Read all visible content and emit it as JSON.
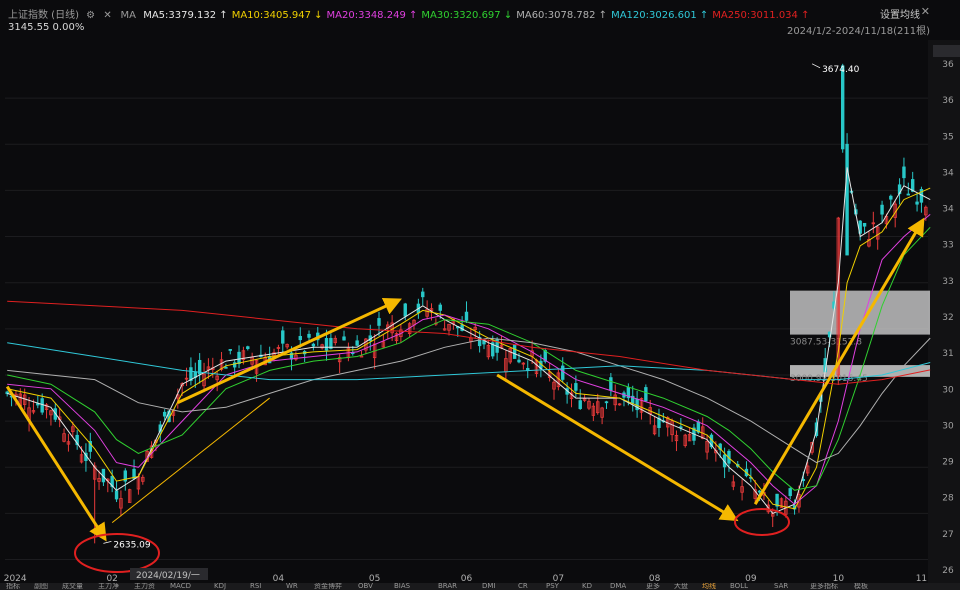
{
  "header": {
    "instrument": "上证指数 (日线)",
    "ma_label": "MA",
    "ma": [
      {
        "text": "MA5:3379.132",
        "arrow": "↑",
        "color": "#e6e6e6"
      },
      {
        "text": "MA10:3405.947",
        "arrow": "↓",
        "color": "#f0d000"
      },
      {
        "text": "MA20:3348.249",
        "arrow": "↑",
        "color": "#e040e0"
      },
      {
        "text": "MA30:3320.697",
        "arrow": "↓",
        "color": "#30d030"
      },
      {
        "text": "MA60:3078.782",
        "arrow": "↑",
        "color": "#b0b0b0"
      },
      {
        "text": "MA120:3026.601",
        "arrow": "↑",
        "color": "#30c8d8"
      },
      {
        "text": "MA250:3011.034",
        "arrow": "↑",
        "color": "#e02020"
      }
    ],
    "price": "3145.55",
    "change": "0.00%",
    "set_ma": "设置均线",
    "range": "2024/1/2-2024/11/18(211根)"
  },
  "colors": {
    "up": "#e83a3a",
    "down": "#28c8c8",
    "arrow": "#f5b800",
    "circle": "#e02020",
    "band": "#d9d9d9",
    "ma5": "#e6e6e6",
    "ma10": "#f0d000",
    "ma20": "#e040e0",
    "ma30": "#30d030",
    "ma60": "#b0b0b0",
    "ma120": "#30c8d8",
    "ma250": "#e02020"
  },
  "chart_data": {
    "type": "candlestick",
    "title": "上证指数 (日线)",
    "x_tick_labels": [
      "2024",
      "02",
      "04",
      "05",
      "06",
      "07",
      "08",
      "09",
      "10",
      "11"
    ],
    "y_ticks": [
      2600,
      2700,
      2800,
      2900,
      3000,
      3100,
      3200,
      3300,
      3400,
      3500,
      3600
    ],
    "y_tick_labels": [
      "26",
      "27",
      "28",
      "29",
      "30",
      "30",
      "31",
      "32",
      "33",
      "33",
      "34",
      "34",
      "35",
      "36",
      "36"
    ],
    "ylim": [
      2560,
      3700
    ],
    "key_points": [
      {
        "label": "2635.09",
        "date": "2024-02-05",
        "value": 2635.09
      },
      {
        "label": "3674.40",
        "date": "2024-10-08",
        "value": 3674.4
      }
    ],
    "crosshair_date": "2024/02/19/一",
    "bands": [
      {
        "label": "3087.53-3152.8",
        "low": 3087.53,
        "high": 3152.8
      },
      {
        "label": "3000.95-3016.45",
        "low": 3000.95,
        "high": 3016.45
      }
    ],
    "trend_arrows": [
      {
        "from": {
          "date": "2024-01-02",
          "value": 2975
        },
        "to": {
          "date": "2024-02-05",
          "value": 2650
        }
      },
      {
        "from": {
          "date": "2024-03-01",
          "value": 2940
        },
        "to": {
          "date": "2024-05-17",
          "value": 3160
        }
      },
      {
        "from": {
          "date": "2024-06-20",
          "value": 3000
        },
        "to": {
          "date": "2024-09-10",
          "value": 2690
        }
      },
      {
        "from": {
          "date": "2024-09-18",
          "value": 2720
        },
        "to": {
          "date": "2024-11-15",
          "value": 3330
        }
      }
    ],
    "ma_lines": [
      {
        "name": "MA5",
        "points": [
          [
            0,
            2960
          ],
          [
            10,
            2930
          ],
          [
            20,
            2800
          ],
          [
            25,
            2750
          ],
          [
            30,
            2780
          ],
          [
            40,
            2980
          ],
          [
            50,
            3030
          ],
          [
            60,
            3045
          ],
          [
            70,
            3060
          ],
          [
            80,
            3060
          ],
          [
            90,
            3120
          ],
          [
            95,
            3150
          ],
          [
            100,
            3120
          ],
          [
            110,
            3070
          ],
          [
            120,
            3030
          ],
          [
            130,
            2950
          ],
          [
            140,
            2950
          ],
          [
            150,
            2900
          ],
          [
            160,
            2860
          ],
          [
            165,
            2800
          ],
          [
            170,
            2760
          ],
          [
            175,
            2700
          ],
          [
            180,
            2720
          ],
          [
            185,
            2880
          ],
          [
            190,
            3200
          ],
          [
            192,
            3450
          ],
          [
            195,
            3300
          ],
          [
            200,
            3330
          ],
          [
            205,
            3410
          ],
          [
            211,
            3380
          ]
        ]
      },
      {
        "name": "MA10",
        "points": [
          [
            0,
            2970
          ],
          [
            10,
            2950
          ],
          [
            20,
            2840
          ],
          [
            25,
            2770
          ],
          [
            30,
            2780
          ],
          [
            40,
            2960
          ],
          [
            50,
            3020
          ],
          [
            60,
            3040
          ],
          [
            70,
            3050
          ],
          [
            80,
            3055
          ],
          [
            90,
            3110
          ],
          [
            95,
            3140
          ],
          [
            100,
            3130
          ],
          [
            110,
            3080
          ],
          [
            120,
            3040
          ],
          [
            130,
            2960
          ],
          [
            140,
            2950
          ],
          [
            150,
            2910
          ],
          [
            160,
            2870
          ],
          [
            165,
            2820
          ],
          [
            170,
            2780
          ],
          [
            175,
            2720
          ],
          [
            180,
            2710
          ],
          [
            185,
            2800
          ],
          [
            190,
            3050
          ],
          [
            192,
            3200
          ],
          [
            195,
            3280
          ],
          [
            200,
            3310
          ],
          [
            205,
            3380
          ],
          [
            211,
            3405
          ]
        ]
      },
      {
        "name": "MA20",
        "points": [
          [
            0,
            2980
          ],
          [
            10,
            2970
          ],
          [
            20,
            2880
          ],
          [
            25,
            2810
          ],
          [
            30,
            2800
          ],
          [
            40,
            2900
          ],
          [
            50,
            3000
          ],
          [
            60,
            3030
          ],
          [
            70,
            3040
          ],
          [
            80,
            3050
          ],
          [
            90,
            3090
          ],
          [
            95,
            3120
          ],
          [
            100,
            3130
          ],
          [
            110,
            3100
          ],
          [
            120,
            3050
          ],
          [
            130,
            2990
          ],
          [
            140,
            2960
          ],
          [
            150,
            2930
          ],
          [
            160,
            2890
          ],
          [
            165,
            2850
          ],
          [
            170,
            2810
          ],
          [
            175,
            2760
          ],
          [
            180,
            2720
          ],
          [
            185,
            2760
          ],
          [
            190,
            2900
          ],
          [
            195,
            3100
          ],
          [
            200,
            3250
          ],
          [
            205,
            3300
          ],
          [
            211,
            3348
          ]
        ]
      },
      {
        "name": "MA30",
        "points": [
          [
            0,
            3000
          ],
          [
            10,
            2980
          ],
          [
            20,
            2920
          ],
          [
            25,
            2860
          ],
          [
            30,
            2830
          ],
          [
            40,
            2870
          ],
          [
            50,
            2970
          ],
          [
            60,
            3010
          ],
          [
            70,
            3030
          ],
          [
            80,
            3040
          ],
          [
            90,
            3070
          ],
          [
            95,
            3100
          ],
          [
            100,
            3120
          ],
          [
            110,
            3110
          ],
          [
            120,
            3070
          ],
          [
            130,
            3010
          ],
          [
            140,
            2980
          ],
          [
            150,
            2950
          ],
          [
            160,
            2910
          ],
          [
            165,
            2880
          ],
          [
            170,
            2840
          ],
          [
            175,
            2790
          ],
          [
            180,
            2750
          ],
          [
            185,
            2760
          ],
          [
            190,
            2860
          ],
          [
            195,
            3000
          ],
          [
            200,
            3150
          ],
          [
            205,
            3260
          ],
          [
            211,
            3320
          ]
        ]
      },
      {
        "name": "MA60",
        "points": [
          [
            0,
            3010
          ],
          [
            20,
            2990
          ],
          [
            30,
            2940
          ],
          [
            40,
            2920
          ],
          [
            50,
            2930
          ],
          [
            60,
            2960
          ],
          [
            70,
            2990
          ],
          [
            80,
            3010
          ],
          [
            90,
            3030
          ],
          [
            100,
            3060
          ],
          [
            110,
            3080
          ],
          [
            120,
            3070
          ],
          [
            130,
            3050
          ],
          [
            140,
            3020
          ],
          [
            150,
            2990
          ],
          [
            160,
            2950
          ],
          [
            170,
            2900
          ],
          [
            180,
            2840
          ],
          [
            185,
            2810
          ],
          [
            190,
            2830
          ],
          [
            195,
            2890
          ],
          [
            200,
            2960
          ],
          [
            205,
            3020
          ],
          [
            211,
            3080
          ]
        ]
      },
      {
        "name": "MA120",
        "points": [
          [
            0,
            3070
          ],
          [
            20,
            3040
          ],
          [
            40,
            3010
          ],
          [
            60,
            2990
          ],
          [
            80,
            2990
          ],
          [
            100,
            3000
          ],
          [
            120,
            3010
          ],
          [
            140,
            3020
          ],
          [
            160,
            3010
          ],
          [
            180,
            2990
          ],
          [
            190,
            2990
          ],
          [
            200,
            3000
          ],
          [
            211,
            3027
          ]
        ]
      },
      {
        "name": "MA250",
        "points": [
          [
            0,
            3160
          ],
          [
            20,
            3150
          ],
          [
            40,
            3140
          ],
          [
            60,
            3120
          ],
          [
            80,
            3100
          ],
          [
            100,
            3090
          ],
          [
            120,
            3060
          ],
          [
            140,
            3040
          ],
          [
            160,
            3010
          ],
          [
            180,
            2990
          ],
          [
            190,
            2980
          ],
          [
            200,
            2990
          ],
          [
            211,
            3011
          ]
        ]
      }
    ]
  },
  "bottom_tabs": [
    "指标",
    "副图",
    "成交量",
    "主力净",
    "主力资",
    "MACD",
    "KDJ",
    "RSI",
    "WR",
    "资金博弈",
    "OBV",
    "BIAS",
    "BRAR",
    "DMI",
    "CR",
    "PSY",
    "KD",
    "DMA",
    "更多",
    "大盘",
    "均线",
    "BOLL",
    "SAR",
    "更多指标",
    "模板"
  ]
}
